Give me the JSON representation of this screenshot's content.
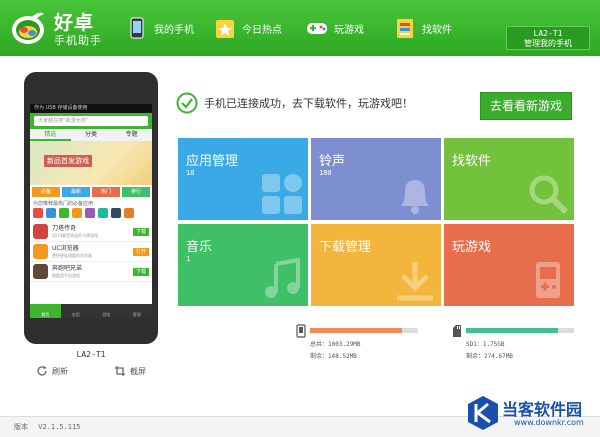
{
  "app": {
    "title": "好卓",
    "subtitle": "手机助手"
  },
  "nav": [
    {
      "label": "我的手机",
      "icon": "phone-icon"
    },
    {
      "label": "今日热点",
      "icon": "star-icon"
    },
    {
      "label": "玩游戏",
      "icon": "gamepad-icon"
    },
    {
      "label": "找软件",
      "icon": "software-box-icon"
    }
  ],
  "device": {
    "name": "LA2-T1",
    "manage_label": "管理我的手机"
  },
  "status": {
    "message": "手机已连接成功，去下载软件，玩游戏吧！",
    "new_games_button": "去看看新游戏"
  },
  "tiles": [
    {
      "label": "应用管理",
      "count": "18",
      "color": "#3aaae6",
      "icon": "apps-grid-icon"
    },
    {
      "label": "铃声",
      "count": "180",
      "color": "#7e8fd1",
      "icon": "bell-icon"
    },
    {
      "label": "找软件",
      "count": "",
      "color": "#73c23c",
      "icon": "search-icon"
    },
    {
      "label": "音乐",
      "count": "1",
      "color": "#3fc067",
      "icon": "music-note-icon"
    },
    {
      "label": "下载管理",
      "count": "",
      "color": "#f3b53b",
      "icon": "download-icon"
    },
    {
      "label": "玩游戏",
      "count": "",
      "color": "#e76e4c",
      "icon": "gamepad-icon"
    }
  ],
  "phone_preview": {
    "status_text": "作为 USB 存储设备使用",
    "search_placeholder": "大家都在搜“新游大帅”",
    "tabs": [
      "精选",
      "分类",
      "专题"
    ],
    "banner_text": "新品首发游戏",
    "categories": [
      {
        "label": "必备",
        "color": "#f39a1e"
      },
      {
        "label": "最新",
        "color": "#3aaae6"
      },
      {
        "label": "热门",
        "color": "#e76e4c"
      },
      {
        "label": "排行",
        "color": "#3fc067"
      }
    ],
    "caption": "为您推荐最热门的必备应用",
    "apps": [
      {
        "name": "刀塔传奇",
        "desc": "2014最受欢迎的卡牌游戏",
        "button": "下载",
        "color": "#d14444"
      },
      {
        "name": "UC浏览器",
        "desc": "更快更省流量的浏览器",
        "button": "打开",
        "color": "#f39a1e"
      },
      {
        "name": "奔跑吧兄弟",
        "desc": "跑酷类手机游戏",
        "button": "下载",
        "color": "#5d4a3a"
      }
    ],
    "bottom_tabs": [
      "首页",
      "应用",
      "游戏",
      "管理"
    ]
  },
  "phone_label": "LA2-T1",
  "phone_actions": {
    "refresh": "刷新",
    "screenshot": "截屏"
  },
  "storage": [
    {
      "icon": "phone-storage-icon",
      "total_label": "总共：",
      "total": "1003.29MB",
      "remain_label": "剩余：",
      "remain": "148.52MB",
      "used_fraction": 0.85,
      "color": "#f08d5b"
    },
    {
      "icon": "sd-card-icon",
      "total_label": "SD1：",
      "total": "1.75GB",
      "remain_label": "剩余：",
      "remain": "274.67MB",
      "used_fraction": 0.85,
      "color": "#44bf8e"
    }
  ],
  "footer": {
    "version_label": "版本",
    "version": "V2.1.5.115"
  },
  "watermark": {
    "text": "当客软件园",
    "url": "www.downkr.com"
  }
}
